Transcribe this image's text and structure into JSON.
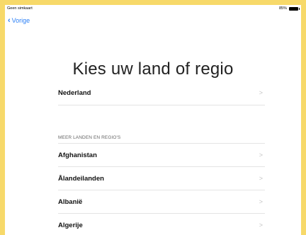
{
  "status_bar": {
    "carrier": "Geen simkaart",
    "battery": "85%"
  },
  "nav": {
    "back_label": "Vorige"
  },
  "title": "Kies uw land of regio",
  "primary": {
    "label": "Nederland"
  },
  "section_header": "MEER LANDEN EN REGIO'S",
  "countries": [
    {
      "label": "Afghanistan"
    },
    {
      "label": "Ålandeilanden"
    },
    {
      "label": "Albanië"
    },
    {
      "label": "Algerije"
    }
  ]
}
